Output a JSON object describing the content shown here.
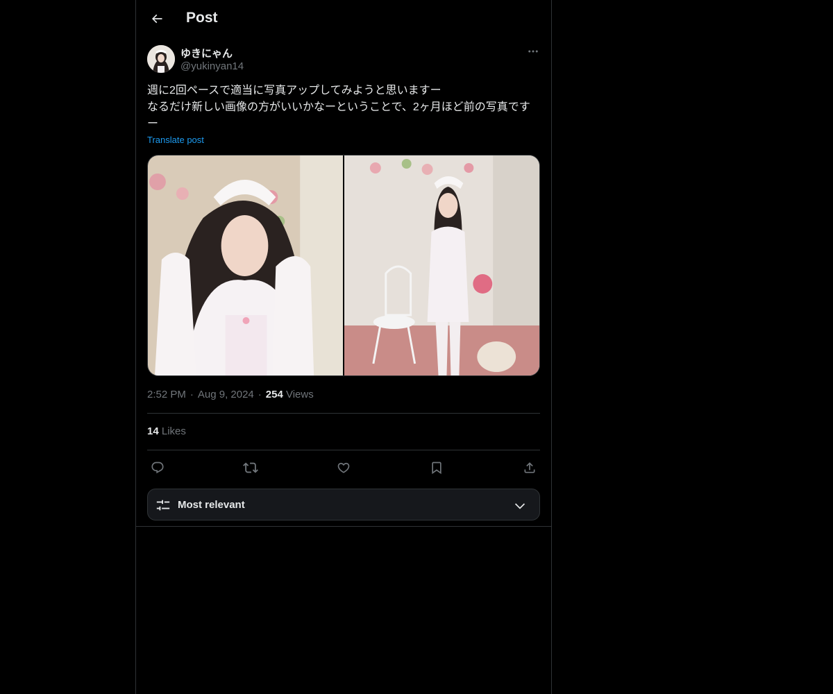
{
  "header": {
    "back_icon": "arrow-left-icon",
    "title": "Post"
  },
  "post": {
    "author": {
      "display_name": "ゆきにゃん",
      "handle": "@yukinyan14",
      "avatar_icon": "avatar-photo"
    },
    "more_icon": "more-horizontal-icon",
    "text": "週に2回ペースで適当に写真アップしてみようと思いますー\nなるだけ新しい画像の方がいいかなーということで、2ヶ月ほど前の写真ですー",
    "translate_label": "Translate post",
    "media_count": 2,
    "time": "2:52 PM",
    "date": "Aug 9, 2024",
    "separator": "·",
    "views_count": "254",
    "views_label": "Views",
    "likes_count": "14",
    "likes_label": "Likes"
  },
  "actions": [
    {
      "name": "reply",
      "icon": "reply-icon"
    },
    {
      "name": "repost",
      "icon": "repost-icon"
    },
    {
      "name": "like",
      "icon": "heart-icon"
    },
    {
      "name": "bookmark",
      "icon": "bookmark-icon"
    },
    {
      "name": "share",
      "icon": "share-icon"
    }
  ],
  "sort": {
    "icon": "sliders-icon",
    "label": "Most relevant",
    "chevron_icon": "chevron-down-icon"
  },
  "colors": {
    "background": "#000000",
    "border": "#2f3336",
    "text_primary": "#e7e9ea",
    "text_secondary": "#71767b",
    "accent": "#1d9bf0"
  }
}
